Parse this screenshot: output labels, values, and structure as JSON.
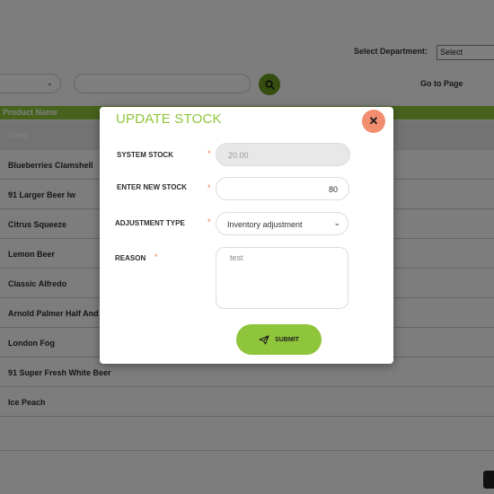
{
  "header": {
    "department_label": "Select Department:",
    "department_value": "Select",
    "goto_label": "Go to Page"
  },
  "table": {
    "column_header": "Product Name",
    "rows": [
      "Bottle",
      "Blueberries Clamshell",
      "91 Larger Beer lw",
      "Citrus Squeeze",
      "Lemon Beer",
      "Classic Alfredo",
      "Arnold Palmer Half And",
      "London Fog",
      "91 Super Fresh White Beer",
      "Ice Peach"
    ]
  },
  "modal": {
    "title": "UPDATE STOCK",
    "close_icon": "close-icon",
    "system_stock_label": "SYSTEM STOCK",
    "system_stock_value": "20.00",
    "new_stock_label": "ENTER NEW STOCK",
    "new_stock_value": "80",
    "adjustment_type_label": "ADJUSTMENT TYPE",
    "adjustment_type_value": "Inventory adjustment",
    "reason_label": "REASON",
    "reason_value": "test",
    "required_mark": "*",
    "submit_label": "SUBMIT"
  },
  "colors": {
    "accent": "#8fc53a",
    "close": "#f28e70",
    "search_button": "#6b9a1f",
    "required": "#f07a50"
  }
}
